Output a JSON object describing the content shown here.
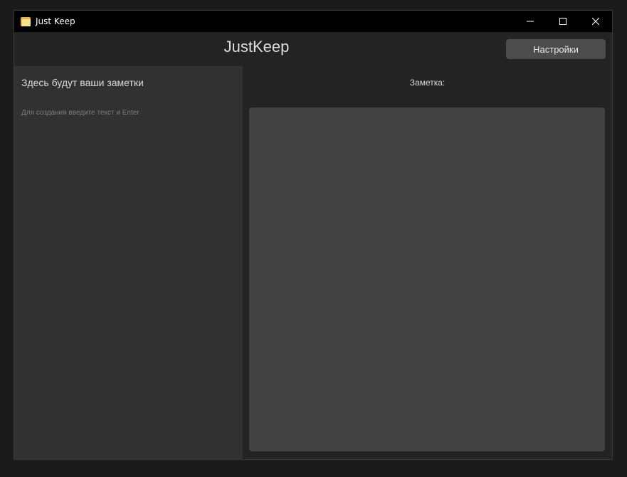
{
  "window": {
    "title": "Just Keep",
    "icon": "notes-app-icon",
    "controls": [
      "minimize-icon",
      "maximize-icon",
      "close-icon"
    ]
  },
  "header": {
    "app_title": "JustKeep",
    "settings_label": "Настройки"
  },
  "sidebar": {
    "heading": "Здесь будут ваши заметки",
    "hint": "Для создания введите текст и Enter"
  },
  "main": {
    "note_label": "Заметка:",
    "note_text": ""
  },
  "colors": {
    "background": "#1b1b19",
    "titlebar": "#000000",
    "header": "#232323",
    "sidebar": "#313131",
    "editor": "#424242",
    "button": "#4c4c4c",
    "text": "#dcdcdc"
  }
}
